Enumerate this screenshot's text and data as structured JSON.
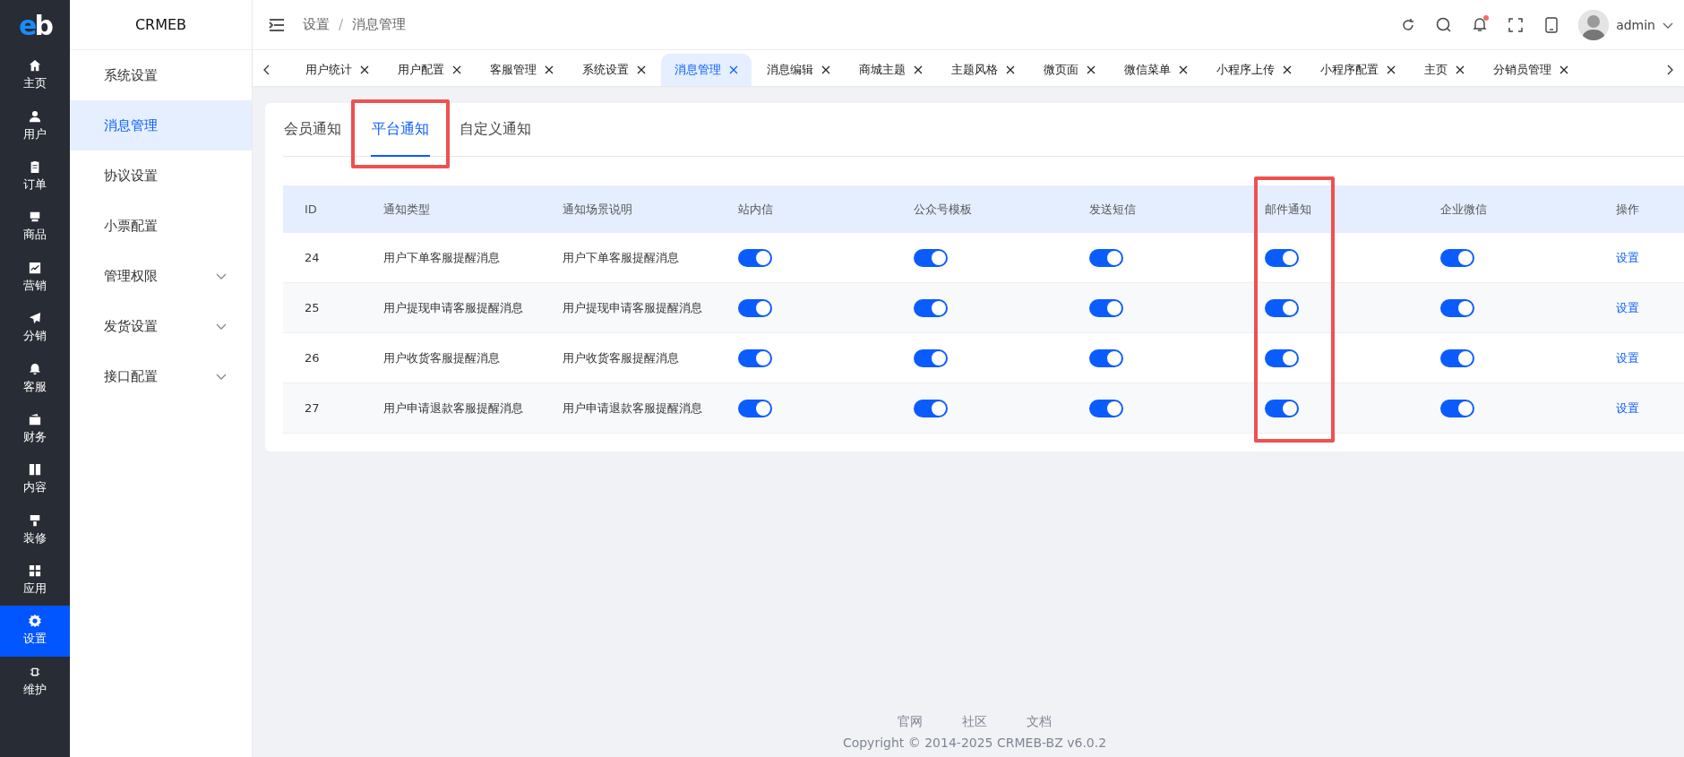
{
  "rail": {
    "logo": "eb",
    "items": [
      {
        "label": "主页",
        "selected": false
      },
      {
        "label": "用户",
        "selected": false
      },
      {
        "label": "订单",
        "selected": false
      },
      {
        "label": "商品",
        "selected": false
      },
      {
        "label": "营销",
        "selected": false
      },
      {
        "label": "分销",
        "selected": false
      },
      {
        "label": "客服",
        "selected": false
      },
      {
        "label": "财务",
        "selected": false
      },
      {
        "label": "内容",
        "selected": false
      },
      {
        "label": "装修",
        "selected": false
      },
      {
        "label": "应用",
        "selected": false
      },
      {
        "label": "设置",
        "selected": true
      },
      {
        "label": "维护",
        "selected": false
      }
    ]
  },
  "sidebar": {
    "title": "CRMEB",
    "items": [
      {
        "label": "系统设置",
        "selected": false,
        "expandable": false
      },
      {
        "label": "消息管理",
        "selected": true,
        "expandable": false
      },
      {
        "label": "协议设置",
        "selected": false,
        "expandable": false
      },
      {
        "label": "小票配置",
        "selected": false,
        "expandable": false
      },
      {
        "label": "管理权限",
        "selected": false,
        "expandable": true
      },
      {
        "label": "发货设置",
        "selected": false,
        "expandable": true
      },
      {
        "label": "接口配置",
        "selected": false,
        "expandable": true
      }
    ]
  },
  "header": {
    "breadcrumb": [
      "设置",
      "消息管理"
    ],
    "breadcrumb_separator": "/",
    "notification_dot": true,
    "user": "admin"
  },
  "page_tabs": [
    {
      "label": "用户统计",
      "selected": false
    },
    {
      "label": "用户配置",
      "selected": false
    },
    {
      "label": "客服管理",
      "selected": false
    },
    {
      "label": "系统设置",
      "selected": false
    },
    {
      "label": "消息管理",
      "selected": true
    },
    {
      "label": "消息编辑",
      "selected": false
    },
    {
      "label": "商城主题",
      "selected": false
    },
    {
      "label": "主题风格",
      "selected": false
    },
    {
      "label": "微页面",
      "selected": false
    },
    {
      "label": "微信菜单",
      "selected": false
    },
    {
      "label": "小程序上传",
      "selected": false
    },
    {
      "label": "小程序配置",
      "selected": false
    },
    {
      "label": "主页",
      "selected": false
    },
    {
      "label": "分销员管理",
      "selected": false
    }
  ],
  "notice_tabs": [
    {
      "label": "会员通知",
      "selected": false,
      "annotated": false
    },
    {
      "label": "平台通知",
      "selected": true,
      "annotated": true
    },
    {
      "label": "自定义通知",
      "selected": false,
      "annotated": false
    }
  ],
  "table": {
    "columns": [
      {
        "label": "ID",
        "kind": "text",
        "annotated": false
      },
      {
        "label": "通知类型",
        "kind": "text",
        "annotated": false
      },
      {
        "label": "通知场景说明",
        "kind": "text",
        "annotated": false
      },
      {
        "label": "站内信",
        "kind": "switch",
        "annotated": false
      },
      {
        "label": "公众号模板",
        "kind": "switch",
        "annotated": false
      },
      {
        "label": "发送短信",
        "kind": "switch",
        "annotated": false
      },
      {
        "label": "邮件通知",
        "kind": "switch",
        "annotated": true
      },
      {
        "label": "企业微信",
        "kind": "switch",
        "annotated": false
      },
      {
        "label": "操作",
        "kind": "link",
        "annotated": false
      }
    ],
    "rows": [
      {
        "cells": [
          {
            "text": "24"
          },
          {
            "text": "用户下单客服提醒消息"
          },
          {
            "text": "用户下单客服提醒消息"
          },
          {
            "on": true
          },
          {
            "on": true
          },
          {
            "on": true
          },
          {
            "on": true
          },
          {
            "on": true
          },
          {
            "text": "设置"
          }
        ]
      },
      {
        "cells": [
          {
            "text": "25"
          },
          {
            "text": "用户提现申请客服提醒消息"
          },
          {
            "text": "用户提现申请客服提醒消息"
          },
          {
            "on": true
          },
          {
            "on": true
          },
          {
            "on": true
          },
          {
            "on": true
          },
          {
            "on": true
          },
          {
            "text": "设置"
          }
        ]
      },
      {
        "cells": [
          {
            "text": "26"
          },
          {
            "text": "用户收货客服提醒消息"
          },
          {
            "text": "用户收货客服提醒消息"
          },
          {
            "on": true
          },
          {
            "on": true
          },
          {
            "on": true
          },
          {
            "on": true
          },
          {
            "on": true
          },
          {
            "text": "设置"
          }
        ]
      },
      {
        "cells": [
          {
            "text": "27"
          },
          {
            "text": "用户申请退款客服提醒消息"
          },
          {
            "text": "用户申请退款客服提醒消息"
          },
          {
            "on": true
          },
          {
            "on": true
          },
          {
            "on": true
          },
          {
            "on": true
          },
          {
            "on": true
          },
          {
            "text": "设置"
          }
        ]
      }
    ]
  },
  "footer": {
    "links": [
      "官网",
      "社区",
      "文档"
    ],
    "copyright": "Copyright © 2014-2025 CRMEB-BZ v6.0.2"
  }
}
